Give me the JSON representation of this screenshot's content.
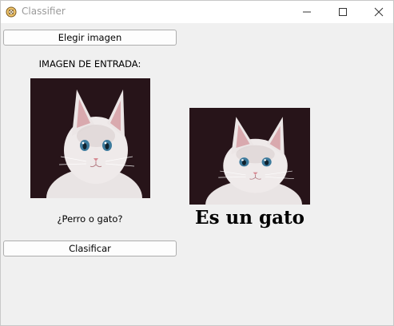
{
  "window": {
    "title": "Classifier",
    "icon": "feather-app-icon",
    "controls": [
      "minimize-icon",
      "maximize-icon",
      "close-icon"
    ]
  },
  "buttons": {
    "choose_image": "Elegir imagen",
    "classify": "Clasificar"
  },
  "labels": {
    "input_image": "IMAGEN DE ENTRADA:",
    "question": "¿Perro o gato?"
  },
  "images": {
    "input": "white-kitten-photo",
    "output": "white-kitten-photo"
  },
  "result": {
    "text": "Es un gato"
  },
  "colors": {
    "background": "#f0f0f0",
    "titlebar": "#ffffff",
    "button_bg": "#fdfdfd",
    "button_border": "#adadad"
  }
}
